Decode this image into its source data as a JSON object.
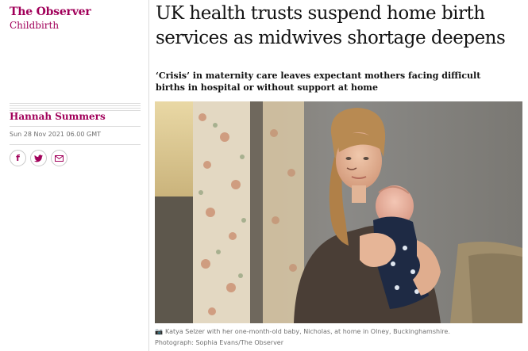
{
  "section": {
    "title": "The Observer",
    "subtitle": "Childbirth"
  },
  "byline": {
    "author": "Hannah Summers",
    "date": "Sun 28 Nov 2021 06.00 GMT"
  },
  "share": [
    {
      "icon": "facebook-icon",
      "glyph": "f"
    },
    {
      "icon": "twitter-icon",
      "glyph": "🐦"
    },
    {
      "icon": "email-icon",
      "glyph": "✉"
    }
  ],
  "article": {
    "headline": "UK health trusts suspend home birth services as midwives shortage deepens",
    "standfirst": "‘Crisis’ in maternity care leaves expectant mothers facing difficult births in hospital or without support at home",
    "caption": "Katya Selzer with her one-month-old baby, Nicholas, at home in Olney, Buckinghamshire.",
    "credit": "Photograph: Sophia Evans/The Observer"
  },
  "colors": {
    "accent": "#a1005a",
    "text": "#121212",
    "muted": "#707070",
    "rule": "#dcdcdc"
  }
}
